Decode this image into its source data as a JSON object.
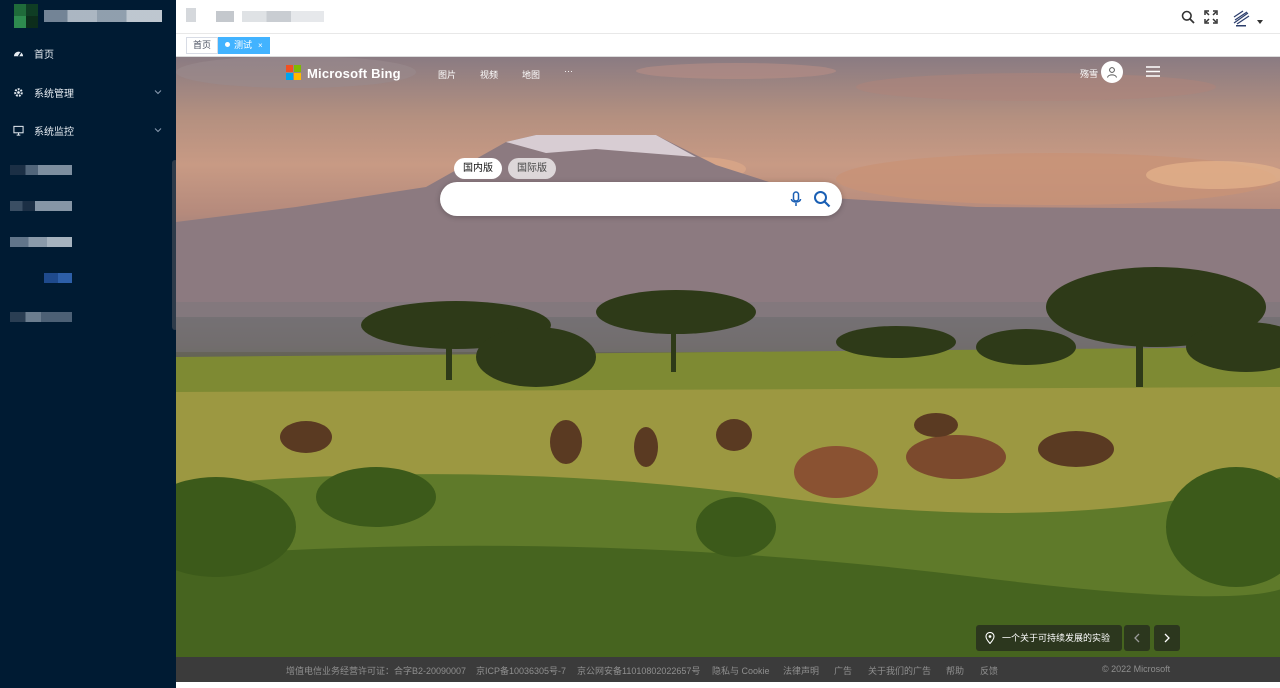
{
  "sidebar": {
    "items": [
      {
        "label": "首页",
        "icon": "dashboard-icon"
      },
      {
        "label": "系统管理",
        "icon": "gear-icon"
      },
      {
        "label": "系统监控",
        "icon": "monitor-icon"
      }
    ]
  },
  "tabs": [
    {
      "label": "首页",
      "active": false
    },
    {
      "label": "测试",
      "active": true,
      "close": "×"
    }
  ],
  "topbar": {
    "icons": [
      "search-icon",
      "fullscreen-icon",
      "user-avatar-icon",
      "caret-down-icon"
    ]
  },
  "bing": {
    "logo_text": "Microsoft Bing",
    "nav": [
      "图片",
      "视频",
      "地图",
      "···"
    ],
    "user_name": "殇雪",
    "region_tabs": [
      "国内版",
      "国际版"
    ],
    "search": {
      "value": "",
      "placeholder": ""
    },
    "story_title": "一个关于可持续发展的实验",
    "nav_prev": "‹",
    "nav_next": "›"
  },
  "footer": {
    "links": [
      "增值电信业务经营许可证：合字B2-20090007",
      "京ICP备10036305号-7",
      "京公网安备11010802022657号",
      "隐私与 Cookie",
      "法律声明",
      "广告",
      "关于我们的广告",
      "帮助",
      "反馈"
    ],
    "copyright": "© 2022 Microsoft"
  },
  "colors": {
    "sidebar_bg": "#001b33",
    "active_tab": "#42b3ff",
    "footer_bg": "#3b3b3b"
  }
}
